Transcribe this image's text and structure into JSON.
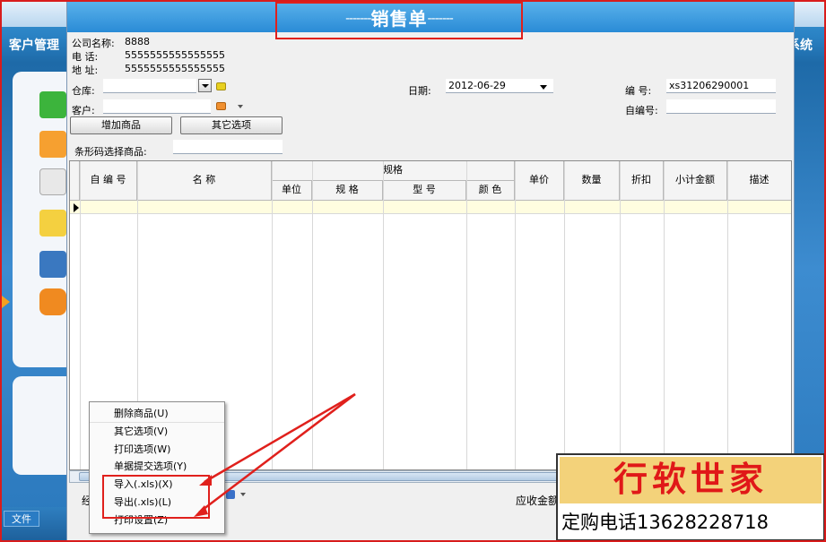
{
  "background_app": {
    "title_left": "客户管理",
    "title_right": "系统",
    "file_tab": "文件"
  },
  "dialog": {
    "title": "销售单",
    "title_dashes": "-------",
    "company": {
      "name_label": "公司名称:",
      "name_value": "8888",
      "phone_label": "电      话:",
      "phone_value": "5555555555555555",
      "address_label": "地      址:",
      "address_value": "5555555555555555"
    },
    "warehouse_label": "仓库:",
    "warehouse_value": "",
    "customer_label": "客户:",
    "customer_value": "",
    "date_label": "日期:",
    "date_value": "2012-06-29",
    "number_label": "编    号:",
    "number_value": "xs31206290001",
    "self_number_label": "自编号:",
    "self_number_value": "",
    "add_product_button": "增加商品",
    "other_options_button": "其它选项",
    "barcode_label": "条形码选择商品:",
    "barcode_value": "",
    "bottom_left_fragment": "经",
    "bottom_label": "应收金额"
  },
  "grid": {
    "columns": {
      "self_no": "自 编 号",
      "name": "名      称",
      "spec_group": "规格",
      "unit": "单位",
      "spec": "规      格",
      "model": "型      号",
      "color": "颜      色",
      "price": "单价",
      "quantity": "数量",
      "discount": "折扣",
      "subtotal": "小计金额",
      "description": "描述"
    },
    "rows": []
  },
  "context_menu": {
    "items": [
      "删除商品(U)",
      "其它选项(V)",
      "打印选项(W)",
      "单据提交选项(Y)",
      "导入(.xls)(X)",
      "导出(.xls)(L)",
      "打印设置(Z)"
    ]
  },
  "ad_banner": {
    "brand": "行软世家",
    "phone": "定购电话13628228718"
  },
  "colors": {
    "annotation_red": "#e0201c",
    "header_blue": "#2a8bd6",
    "row_highlight": "#fffde0",
    "ad_red": "#e01818"
  }
}
